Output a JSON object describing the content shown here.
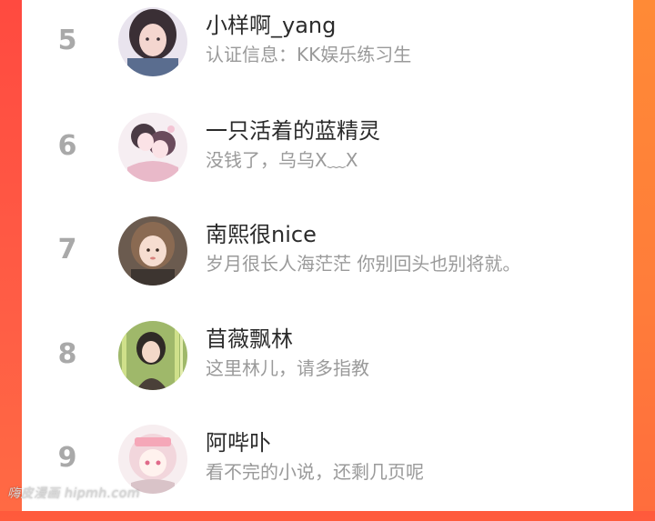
{
  "colors": {
    "accent_left": "#ff4a40",
    "accent_right": "#ff8a36",
    "rank": "#a9a9a9",
    "name": "#2b2b2b",
    "sign": "#9a9a9a"
  },
  "list": [
    {
      "rank": "5",
      "name": "小样啊_yang",
      "sign": "认证信息：KK娱乐练习生",
      "avatar": "avatar-girl-photo"
    },
    {
      "rank": "6",
      "name": "一只活着的蓝精灵",
      "sign": "没钱了，乌乌X﹏X",
      "avatar": "avatar-anime-couple"
    },
    {
      "rank": "7",
      "name": "南熙很nice",
      "sign": "岁月很长人海茫茫 你别回头也别将就。",
      "avatar": "avatar-girl-selfie"
    },
    {
      "rank": "8",
      "name": "苜薇飘林",
      "sign": "这里林儿，请多指教",
      "avatar": "avatar-girl-bamboo"
    },
    {
      "rank": "9",
      "name": "阿哔卟",
      "sign": "看不完的小说，还剩几页呢",
      "avatar": "avatar-anime-pink"
    }
  ],
  "watermark": "嗨皮漫画 hipmh.com"
}
